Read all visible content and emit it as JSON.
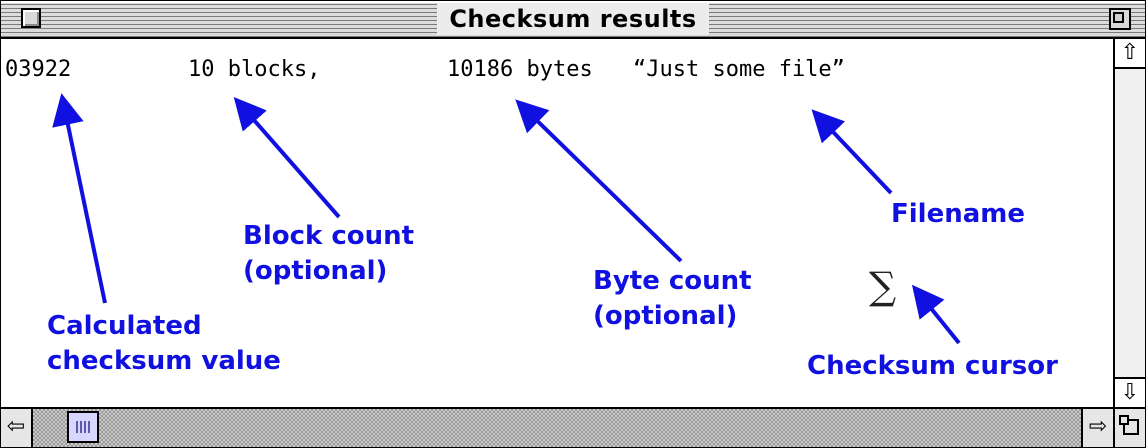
{
  "window": {
    "title": "Checksum results"
  },
  "result": {
    "checksum": "03922",
    "blocks": "10 blocks,",
    "bytes": "10186 bytes",
    "filename": "“Just some file”"
  },
  "annotations": {
    "checksum_line1": "Calculated",
    "checksum_line2": "checksum value",
    "blocks_line1": "Block count",
    "blocks_line2": "(optional)",
    "bytes_line1": "Byte count",
    "bytes_line2": "(optional)",
    "filename": "Filename",
    "cursor": "Checksum cursor"
  },
  "cursor_glyph": "∑",
  "icons": {
    "scroll_up": "⇧",
    "scroll_down": "⇩",
    "scroll_left": "⇦",
    "scroll_right": "⇨"
  },
  "colors": {
    "annotation": "#1010e0",
    "arrow": "#1010e0"
  }
}
